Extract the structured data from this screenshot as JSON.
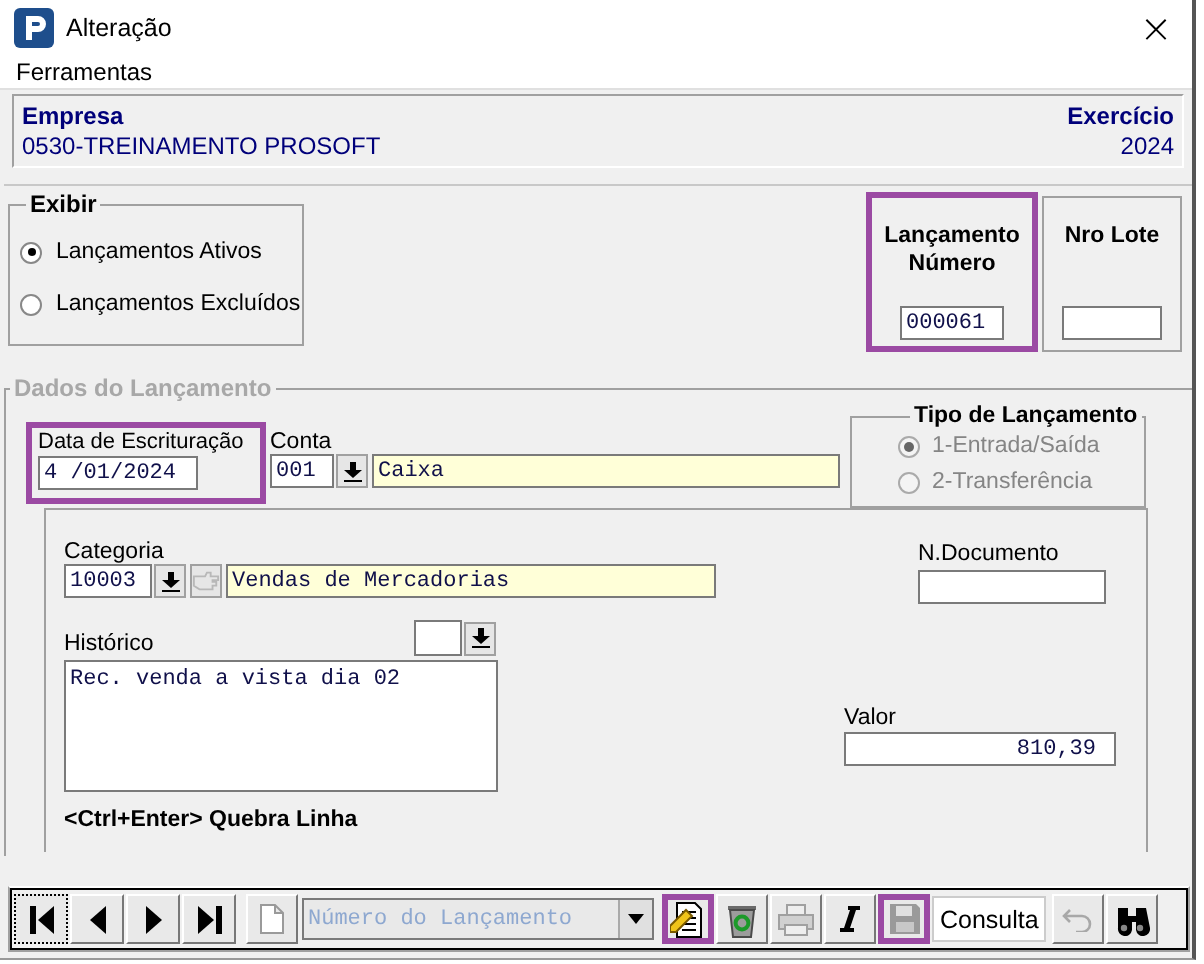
{
  "window": {
    "title": "Alteração",
    "close": "×"
  },
  "menu": [
    "Ferramentas"
  ],
  "header": {
    "company_label": "Empresa",
    "company": "0530-TREINAMENTO PROSOFT",
    "year_label": "Exercício",
    "year": "2024"
  },
  "show_group": {
    "title": "Exibir",
    "options": [
      {
        "label": "Lançamentos Ativos",
        "selected": true
      },
      {
        "label": "Lançamentos Excluídos",
        "selected": false
      }
    ]
  },
  "entry_number": {
    "label": "Lançamento Número",
    "value": "000061",
    "highlighted": true
  },
  "batch": {
    "label": "Nro Lote"
  },
  "details": {
    "title": "Dados do Lançamento",
    "date": {
      "label": "Data de Escrituração",
      "value": "4 /01/2024",
      "highlighted": true
    },
    "account": {
      "label": "Conta",
      "code": "001",
      "name": "Caixa"
    },
    "entry_type": {
      "title": "Tipo de Lançamento",
      "disabled": true,
      "options": [
        {
          "label": "1-Entrada/Saída",
          "selected": true
        },
        {
          "label": "2-Transferência",
          "selected": false
        }
      ]
    },
    "category": {
      "label": "Categoria",
      "code": "10003",
      "name": "Vendas de Mercadorias"
    },
    "document": {
      "label": "N.Documento"
    },
    "history": {
      "label": "Histórico",
      "value": "Rec. venda a vista dia 02"
    },
    "amount": {
      "label": "Valor",
      "value": "810,39"
    },
    "hint": "<Ctrl+Enter> Quebra Linha"
  },
  "toolbar": [
    {
      "kind": "first",
      "disabled": false,
      "highlighted": false
    },
    {
      "kind": "prev",
      "disabled": false,
      "highlighted": false
    },
    {
      "kind": "next",
      "disabled": false,
      "highlighted": false
    },
    {
      "kind": "last",
      "disabled": false,
      "highlighted": false
    },
    {
      "kind": "new",
      "disabled": true,
      "highlighted": false
    },
    {
      "kind": "combo",
      "placeholder": "Número do Lançamento"
    },
    {
      "kind": "edit",
      "disabled": false,
      "highlighted": true
    },
    {
      "kind": "delete",
      "disabled": false,
      "highlighted": false
    },
    {
      "kind": "print",
      "disabled": true,
      "highlighted": false
    },
    {
      "kind": "italic",
      "disabled": false,
      "highlighted": false
    },
    {
      "kind": "save",
      "disabled": true,
      "highlighted": true
    },
    {
      "kind": "text",
      "label": "Consulta"
    },
    {
      "kind": "undo",
      "disabled": true,
      "highlighted": false
    },
    {
      "kind": "find",
      "disabled": false,
      "highlighted": false
    }
  ]
}
